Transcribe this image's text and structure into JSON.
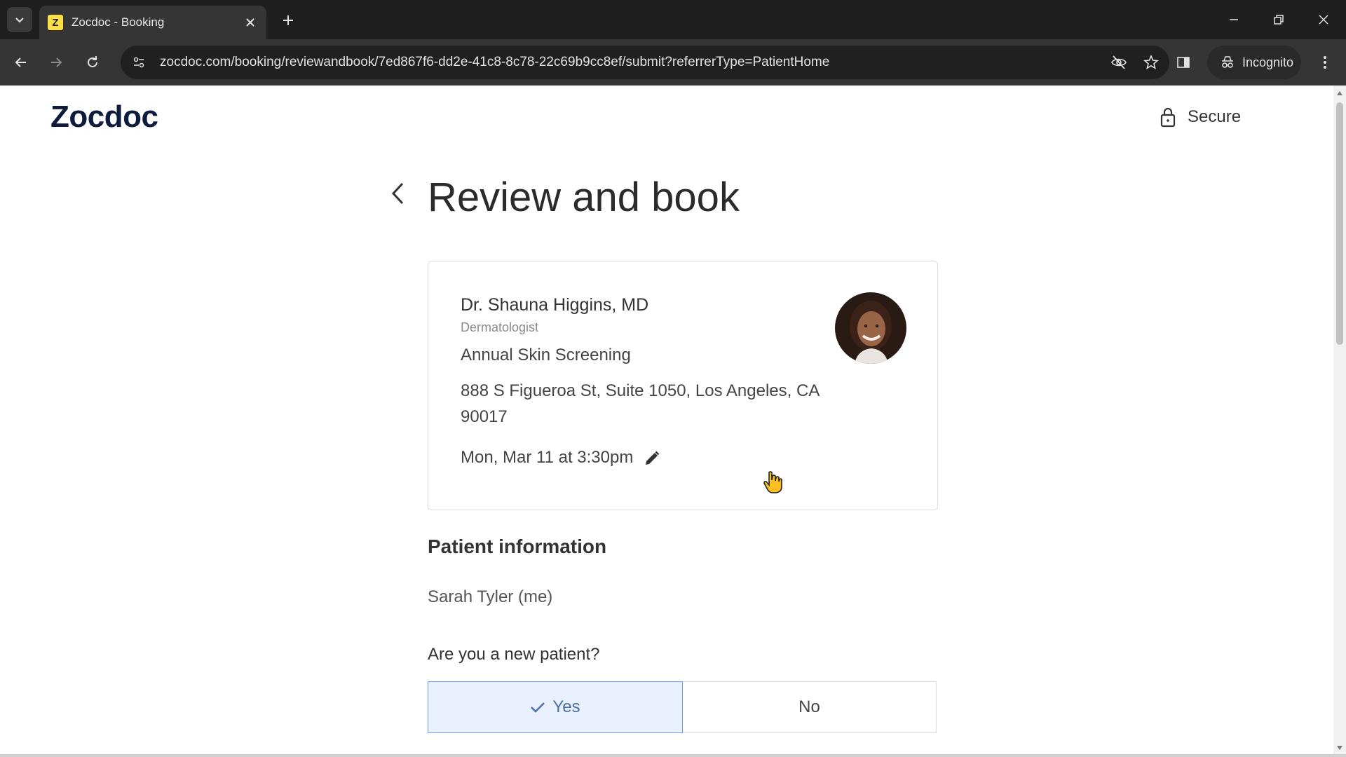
{
  "browser": {
    "tab_title": "Zocdoc - Booking",
    "favicon_letter": "Z",
    "url": "zocdoc.com/booking/reviewandbook/7ed867f6-dd2e-41c8-8c78-22c69b9cc8ef/submit?referrerType=PatientHome",
    "incognito_label": "Incognito",
    "icons": [
      "tab-search-icon",
      "close-icon",
      "plus-icon",
      "minimize-icon",
      "restore-icon",
      "window-close-icon",
      "back-icon",
      "forward-icon",
      "reload-icon",
      "site-info-icon",
      "eye-off-icon",
      "star-icon",
      "sidepanel-icon",
      "incognito-icon",
      "more-icon"
    ]
  },
  "header": {
    "logo": "Zocdoc",
    "secure_label": "Secure"
  },
  "page": {
    "title": "Review and book"
  },
  "appointment": {
    "doctor_name": "Dr. Shauna Higgins, MD",
    "specialty": "Dermatologist",
    "visit_reason": "Annual Skin Screening",
    "address": "888 S Figueroa St, Suite 1050, Los Angeles, CA 90017",
    "datetime": "Mon, Mar 11 at 3:30pm"
  },
  "patient": {
    "section_title": "Patient information",
    "name": "Sarah Tyler (me)",
    "new_patient_question": "Are you a new patient?",
    "options": [
      {
        "label": "Yes",
        "selected": true
      },
      {
        "label": "No",
        "selected": false
      }
    ]
  },
  "colors": {
    "brand_navy": "#0f1b3d",
    "selected_bg": "#e8f1fd",
    "selected_border": "#6b9ee8",
    "favicon_yellow": "#fde047"
  }
}
